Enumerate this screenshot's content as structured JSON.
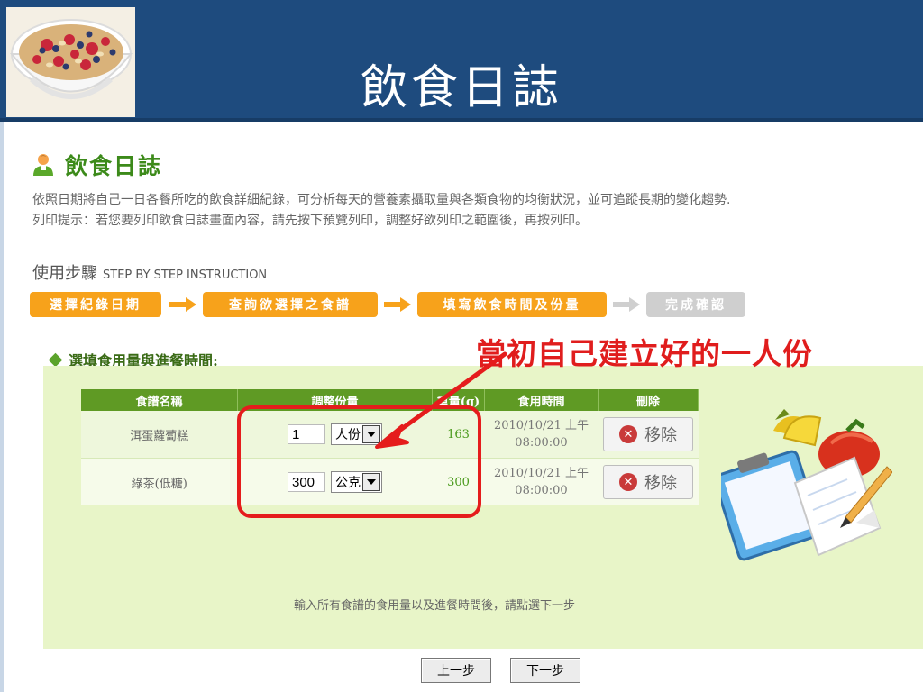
{
  "slide": {
    "title": "飲食日誌"
  },
  "page": {
    "heading": "飲食日誌",
    "description_line1": "依照日期將自己一日各餐所吃的飲食詳細紀錄，可分析每天的營養素攝取量與各類食物的均衡狀況，並可追蹤長期的變化趨勢.",
    "description_line2": "列印提示：若您要列印飲食日誌畫面內容，請先按下預覽列印，調整好欲列印之範圍後，再按列印。"
  },
  "steps": {
    "title": "使用步驟",
    "subtitle": "STEP BY STEP INSTRUCTION",
    "items": [
      {
        "label": "選擇紀錄日期",
        "state": "active"
      },
      {
        "label": "查詢欲選擇之食譜",
        "state": "active"
      },
      {
        "label": "填寫飲食時間及份量",
        "state": "active"
      },
      {
        "label": "完成確認",
        "state": "inactive"
      }
    ]
  },
  "section": {
    "label": "選填食用量與進餐時間:"
  },
  "annotation": {
    "text": "當初自己建立好的一人份"
  },
  "table": {
    "headers": [
      "食譜名稱",
      "調整份量",
      "重量(g)",
      "食用時間",
      "刪除"
    ],
    "rows": [
      {
        "name": "洱蛋蘿蔔糕",
        "amount": "1",
        "unit": "人份",
        "weight": "163",
        "time_line1": "2010/10/21 上午",
        "time_line2": "08:00:00",
        "remove_label": "移除"
      },
      {
        "name": "綠茶(低糖)",
        "amount": "300",
        "unit": "公克",
        "weight": "300",
        "time_line1": "2010/10/21 上午",
        "time_line2": "08:00:00",
        "remove_label": "移除"
      }
    ]
  },
  "hint": "輸入所有食譜的食用量以及進餐時間後，請點選下一步",
  "nav": {
    "prev": "上一步",
    "next": "下一步"
  },
  "colors": {
    "header": "#1e4b7e",
    "accent_green": "#5f9a24",
    "step_orange": "#f7a21b",
    "annotation_red": "#e51c1c",
    "panel_green": "#e8f5c8"
  }
}
